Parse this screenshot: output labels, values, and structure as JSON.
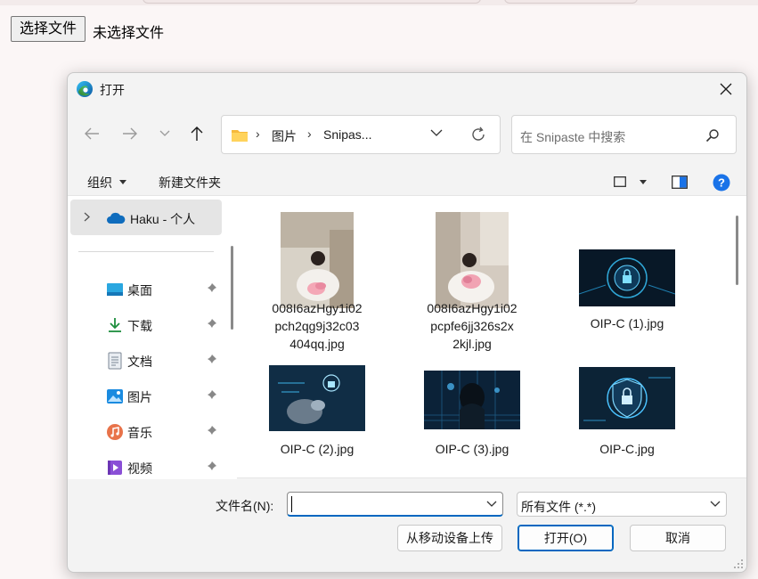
{
  "page": {
    "file_button_label": "选择文件",
    "file_status": "未选择文件"
  },
  "dialog": {
    "title": "打开",
    "icon": "edge-browser-icon",
    "address": {
      "crumbs": [
        "图片",
        "Snipas..."
      ],
      "separator": "›"
    },
    "search_placeholder": "在 Snipaste 中搜索",
    "toolbar": {
      "organize": "组织",
      "new_folder": "新建文件夹"
    },
    "nav": {
      "onedrive_label": "Haku - 个人",
      "items": [
        {
          "label": "桌面",
          "icon": "desktop-icon"
        },
        {
          "label": "下载",
          "icon": "download-icon"
        },
        {
          "label": "文档",
          "icon": "document-icon"
        },
        {
          "label": "图片",
          "icon": "pictures-icon"
        },
        {
          "label": "音乐",
          "icon": "music-icon"
        },
        {
          "label": "视频",
          "icon": "video-icon"
        }
      ]
    },
    "files": [
      {
        "name": "008I6azHgy1i02pch2qg9j32c03404qq.jpg",
        "lines": [
          "008I6azHgy1i02",
          "pch2qg9j32c03",
          "404qq.jpg"
        ]
      },
      {
        "name": "008I6azHgy1i02pcpfe6jj326s2x2kjl.jpg",
        "lines": [
          "008I6azHgy1i02",
          "pcpfe6jj326s2x",
          "2kjl.jpg"
        ]
      },
      {
        "name": "OIP-C (1).jpg",
        "lines": [
          "OIP-C (1).jpg"
        ]
      },
      {
        "name": "OIP-C (2).jpg",
        "lines": [
          "OIP-C (2).jpg"
        ]
      },
      {
        "name": "OIP-C (3).jpg",
        "lines": [
          "OIP-C (3).jpg"
        ]
      },
      {
        "name": "OIP-C.jpg",
        "lines": [
          "OIP-C.jpg"
        ]
      }
    ],
    "filename_label": "文件名(N):",
    "filename_value": "",
    "filetype_value": "所有文件 (*.*)",
    "buttons": {
      "upload": "从移动设备上传",
      "open": "打开(O)",
      "cancel": "取消"
    },
    "colors": {
      "accent": "#0067c0",
      "help": "#1a73e8"
    }
  }
}
